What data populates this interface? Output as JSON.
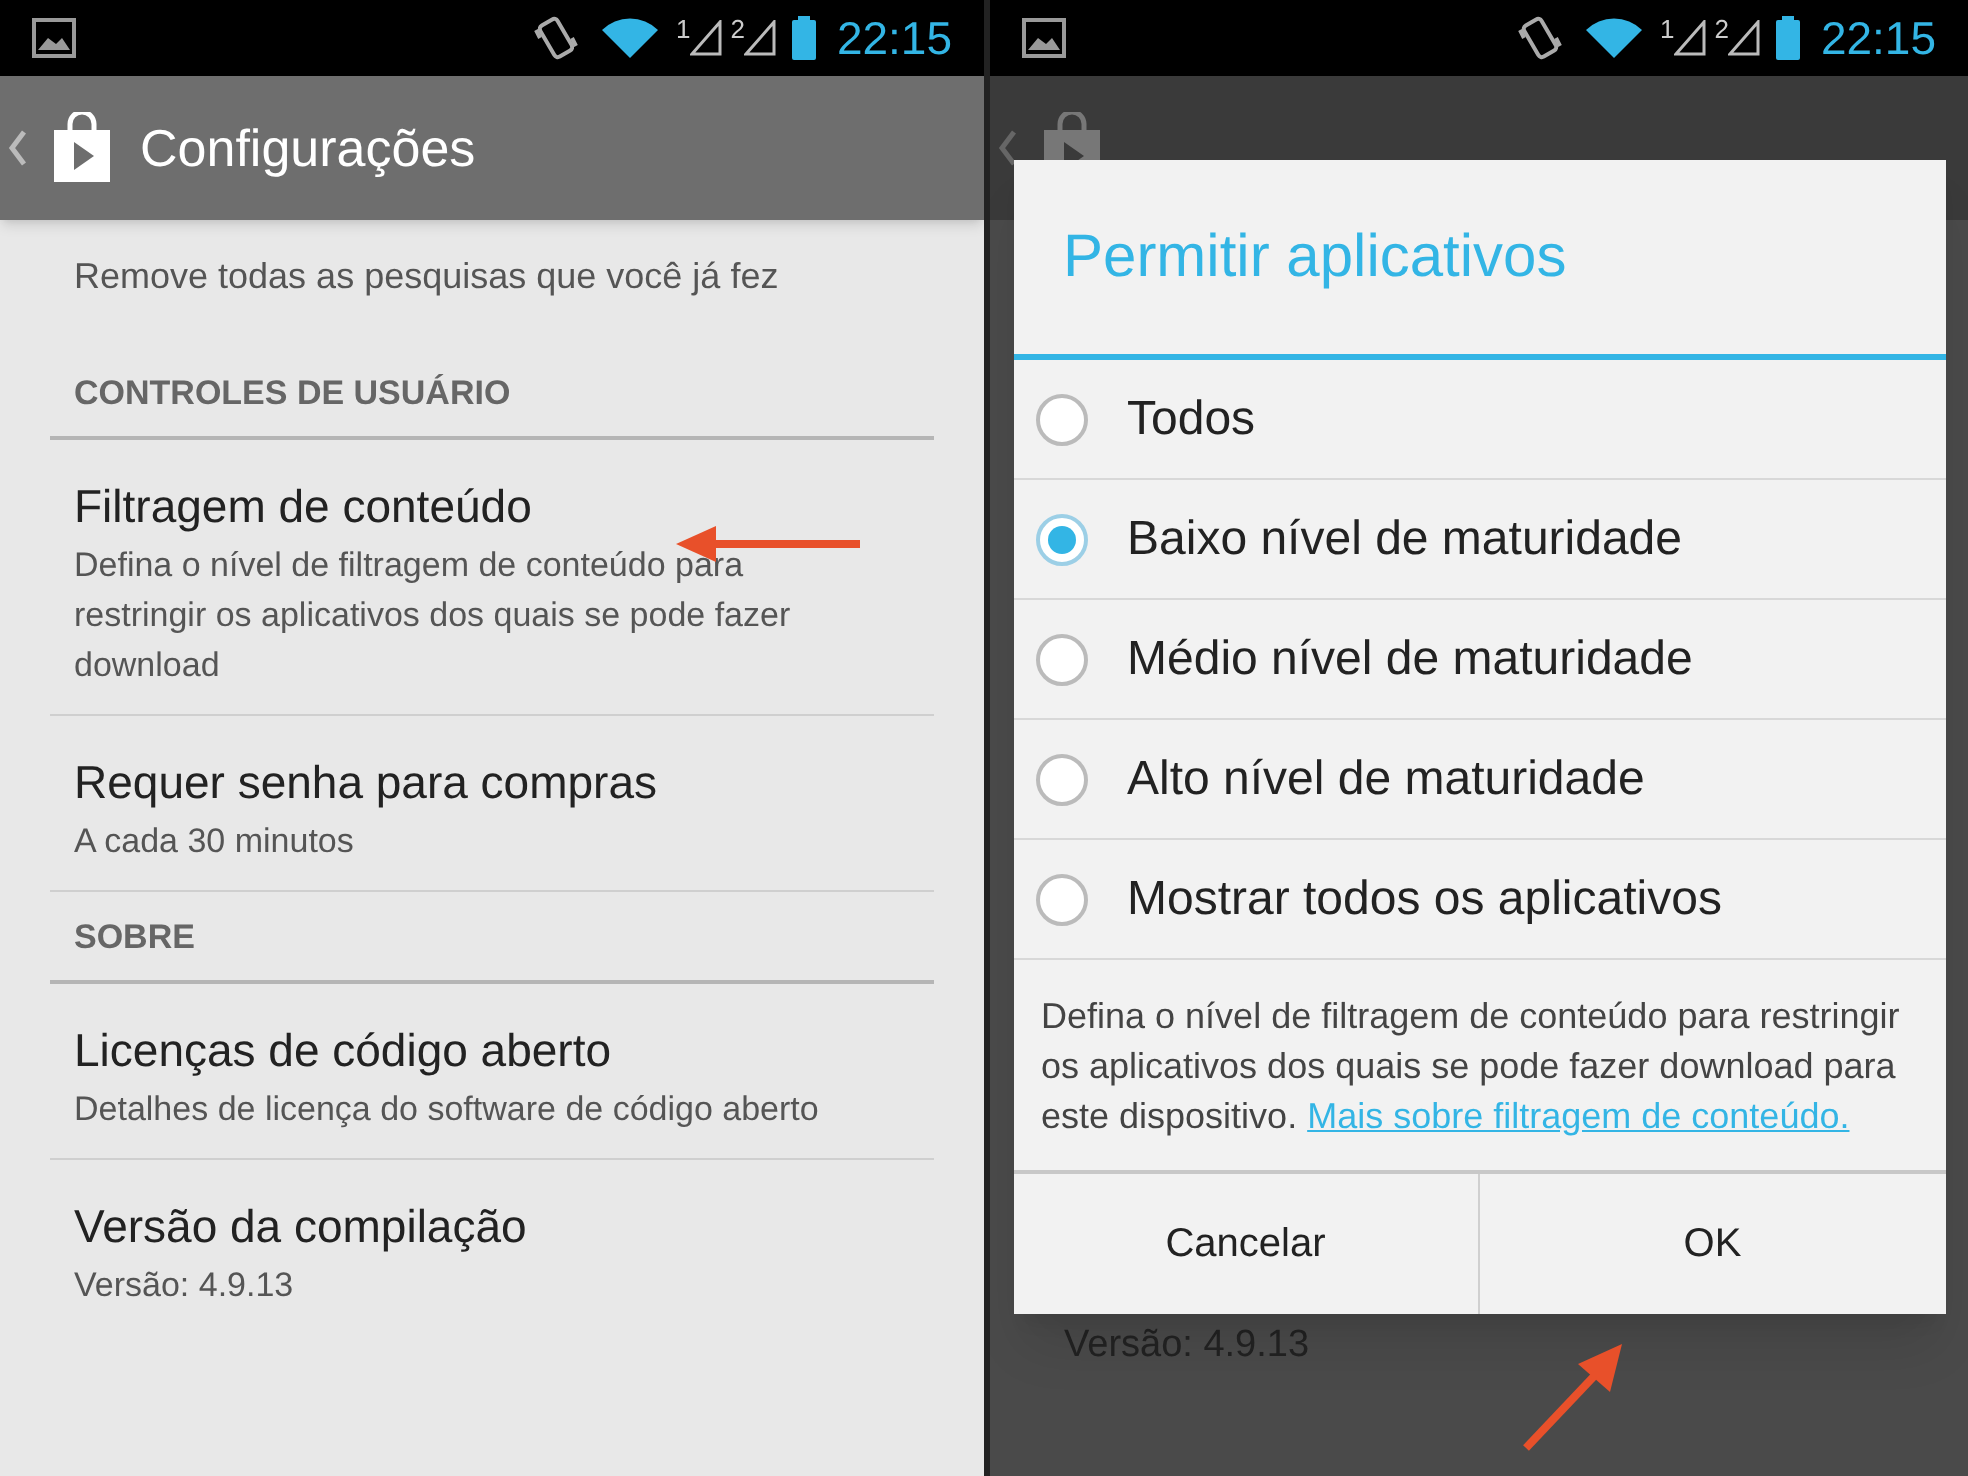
{
  "settings_screen": {
    "status_bar": {
      "sim_slots": [
        "1",
        "2"
      ],
      "time": "22:15"
    },
    "title": "Configurações",
    "items": [
      {
        "kind": "summary",
        "summary": "Remove todas as pesquisas que você já fez"
      },
      {
        "kind": "header",
        "label": "CONTROLES DE USUÁRIO"
      },
      {
        "kind": "setting",
        "title": "Filtragem de conteúdo",
        "summary": "Defina o nível de filtragem de conteúdo para restringir os aplicativos dos quais se pode fazer download"
      },
      {
        "kind": "setting",
        "title": "Requer senha para compras",
        "summary": "A cada 30 minutos"
      },
      {
        "kind": "header",
        "label": "SOBRE"
      },
      {
        "kind": "setting",
        "title": "Licenças de código aberto",
        "summary": "Detalhes de licença do software de código aberto"
      },
      {
        "kind": "setting",
        "title": "Versão da compilação",
        "summary": "Versão: 4.9.13"
      }
    ]
  },
  "dialog_screen": {
    "status_bar": {
      "sim_slots": [
        "1",
        "2"
      ],
      "time": "22:15"
    },
    "background_text": "Versão: 4.9.13",
    "dialog": {
      "title": "Permitir aplicativos",
      "options": [
        {
          "label": "Todos",
          "selected": false
        },
        {
          "label": "Baixo nível de maturidade",
          "selected": true
        },
        {
          "label": "Médio nível de maturidade",
          "selected": false
        },
        {
          "label": "Alto nível de maturidade",
          "selected": false
        },
        {
          "label": "Mostrar todos os aplicativos",
          "selected": false
        }
      ],
      "description": "Defina o nível de filtragem de conteúdo para restringir os aplicativos dos quais se pode fazer download para este dispositivo.",
      "link": "Mais sobre filtragem de conteúdo.",
      "buttons": [
        "Cancelar",
        "OK"
      ]
    }
  }
}
